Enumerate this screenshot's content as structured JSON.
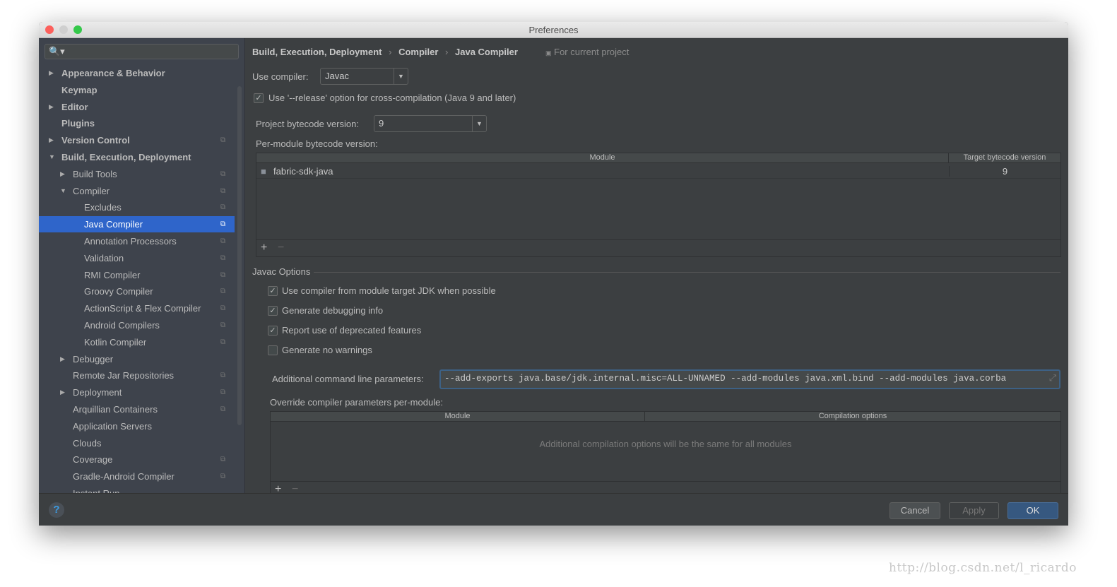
{
  "window": {
    "title": "Preferences"
  },
  "sidebar": {
    "search_placeholder": "",
    "items": [
      {
        "label": "Appearance & Behavior",
        "level": 0,
        "arrow": "right",
        "bold": true,
        "copy": false
      },
      {
        "label": "Keymap",
        "level": 0,
        "arrow": "none",
        "bold": true,
        "copy": false
      },
      {
        "label": "Editor",
        "level": 0,
        "arrow": "right",
        "bold": true,
        "copy": false
      },
      {
        "label": "Plugins",
        "level": 0,
        "arrow": "none",
        "bold": true,
        "copy": false
      },
      {
        "label": "Version Control",
        "level": 0,
        "arrow": "right",
        "bold": true,
        "copy": true
      },
      {
        "label": "Build, Execution, Deployment",
        "level": 0,
        "arrow": "down",
        "bold": true,
        "copy": false
      },
      {
        "label": "Build Tools",
        "level": 1,
        "arrow": "right",
        "bold": false,
        "copy": true
      },
      {
        "label": "Compiler",
        "level": 1,
        "arrow": "down",
        "bold": false,
        "copy": true
      },
      {
        "label": "Excludes",
        "level": 2,
        "arrow": "none",
        "bold": false,
        "copy": true
      },
      {
        "label": "Java Compiler",
        "level": 2,
        "arrow": "none",
        "bold": false,
        "copy": true,
        "selected": true
      },
      {
        "label": "Annotation Processors",
        "level": 2,
        "arrow": "none",
        "bold": false,
        "copy": true
      },
      {
        "label": "Validation",
        "level": 2,
        "arrow": "none",
        "bold": false,
        "copy": true
      },
      {
        "label": "RMI Compiler",
        "level": 2,
        "arrow": "none",
        "bold": false,
        "copy": true
      },
      {
        "label": "Groovy Compiler",
        "level": 2,
        "arrow": "none",
        "bold": false,
        "copy": true
      },
      {
        "label": "ActionScript & Flex Compiler",
        "level": 2,
        "arrow": "none",
        "bold": false,
        "copy": true
      },
      {
        "label": "Android Compilers",
        "level": 2,
        "arrow": "none",
        "bold": false,
        "copy": true
      },
      {
        "label": "Kotlin Compiler",
        "level": 2,
        "arrow": "none",
        "bold": false,
        "copy": true
      },
      {
        "label": "Debugger",
        "level": 1,
        "arrow": "right",
        "bold": false,
        "copy": false
      },
      {
        "label": "Remote Jar Repositories",
        "level": 1,
        "arrow": "none",
        "bold": false,
        "copy": true
      },
      {
        "label": "Deployment",
        "level": 1,
        "arrow": "right",
        "bold": false,
        "copy": true
      },
      {
        "label": "Arquillian Containers",
        "level": 1,
        "arrow": "none",
        "bold": false,
        "copy": true
      },
      {
        "label": "Application Servers",
        "level": 1,
        "arrow": "none",
        "bold": false,
        "copy": false
      },
      {
        "label": "Clouds",
        "level": 1,
        "arrow": "none",
        "bold": false,
        "copy": false
      },
      {
        "label": "Coverage",
        "level": 1,
        "arrow": "none",
        "bold": false,
        "copy": true
      },
      {
        "label": "Gradle-Android Compiler",
        "level": 1,
        "arrow": "none",
        "bold": false,
        "copy": true
      },
      {
        "label": "Instant Run",
        "level": 1,
        "arrow": "none",
        "bold": false,
        "copy": false
      }
    ]
  },
  "breadcrumb": {
    "items": [
      "Build, Execution, Deployment",
      "Compiler",
      "Java Compiler"
    ],
    "separator": "›",
    "scope": "For current project"
  },
  "compiler": {
    "label": "Use compiler:",
    "value": "Javac"
  },
  "release_option": {
    "label": "Use '--release' option for cross-compilation (Java 9 and later)",
    "checked": true
  },
  "bytecode": {
    "label": "Project bytecode version:",
    "value": "9",
    "per_module_label": "Per-module bytecode version:"
  },
  "module_table": {
    "columns": [
      "Module",
      "Target bytecode version"
    ],
    "rows": [
      {
        "module": "fabric-sdk-java",
        "version": "9"
      }
    ],
    "add": "+",
    "remove": "−"
  },
  "javac": {
    "title": "Javac Options",
    "options": [
      {
        "label": "Use compiler from module target JDK when possible",
        "checked": true
      },
      {
        "label": "Generate debugging info",
        "checked": true
      },
      {
        "label": "Report use of deprecated features",
        "checked": true
      },
      {
        "label": "Generate no warnings",
        "checked": false
      }
    ],
    "params_label": "Additional command line parameters:",
    "params_value": "--add-exports java.base/jdk.internal.misc=ALL-UNNAMED --add-modules java.xml.bind --add-modules java.corba",
    "override_label": "Override compiler parameters per-module:",
    "override_columns": [
      "Module",
      "Compilation options"
    ],
    "override_empty": "Additional compilation options will be the same for all modules",
    "add": "+",
    "remove": "−"
  },
  "buttons": {
    "help": "?",
    "cancel": "Cancel",
    "apply": "Apply",
    "ok": "OK"
  },
  "colors": {
    "selection": "#2f65ca",
    "ok_button": "#365880",
    "focus": "#3d6185"
  },
  "watermark": "http://blog.csdn.net/l_ricardo"
}
